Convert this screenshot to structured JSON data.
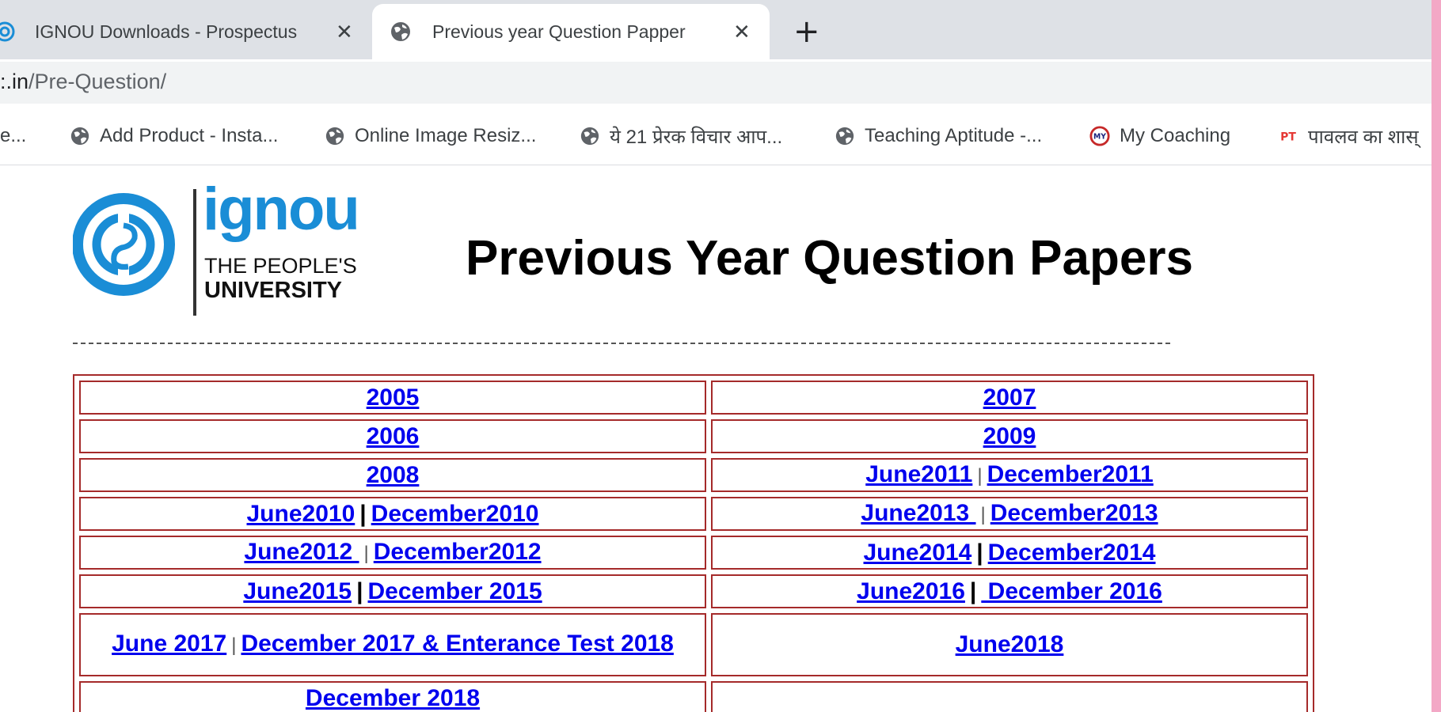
{
  "browser": {
    "tabs": [
      {
        "title": "IGNOU Downloads - Prospectus",
        "close": "✕",
        "active": false
      },
      {
        "title": "Previous year Question Papper",
        "close": "✕",
        "active": true
      }
    ],
    "new_tab": "+",
    "address": {
      "host": ":.in",
      "path": "/Pre-Question/"
    },
    "bookmarks": [
      {
        "label": "e...",
        "icon": "none"
      },
      {
        "label": "Add Product - Insta...",
        "icon": "globe-icon"
      },
      {
        "label": "Online Image Resiz...",
        "icon": "globe-icon"
      },
      {
        "label": "ये 21 प्रेरक विचार आप...",
        "icon": "globe-icon"
      },
      {
        "label": "Teaching Aptitude -...",
        "icon": "globe-icon"
      },
      {
        "label": "My Coaching",
        "icon": "my-coaching-logo-icon"
      },
      {
        "label": "पावलव का शास्",
        "icon": "pt-icon"
      }
    ]
  },
  "page": {
    "logo": {
      "brand": "ignou",
      "tagline": "THE PEOPLE'S",
      "subline": "UNIVERSITY"
    },
    "title": "Previous Year Question Papers",
    "separator": "------------------------------------------------------------------------------------------------------------",
    "colors": {
      "link": "#0000ee",
      "table_border": "#a52a2a",
      "logo_blue": "#1a8dd6"
    },
    "rows": [
      {
        "left": [
          "2005"
        ],
        "right": [
          "2007"
        ]
      },
      {
        "left": [
          "2006"
        ],
        "right": [
          "2009"
        ]
      },
      {
        "left": [
          "2008"
        ],
        "right": [
          "June2011",
          "December2011"
        ]
      },
      {
        "left": [
          "June2010",
          "December2010"
        ],
        "right": [
          "June2013 ",
          "December2013"
        ]
      },
      {
        "left": [
          "June2012 ",
          "December2012"
        ],
        "right": [
          "June2014",
          "December2014"
        ]
      },
      {
        "left": [
          "June2015",
          "December 2015"
        ],
        "right": [
          "June2016",
          " December 2016"
        ]
      },
      {
        "left": [
          "June 2017",
          "December 2017 & Enterance Test 2018"
        ],
        "right": [
          "June2018"
        ]
      },
      {
        "left": [
          "December 2018"
        ],
        "right": []
      }
    ],
    "divider": "|"
  }
}
